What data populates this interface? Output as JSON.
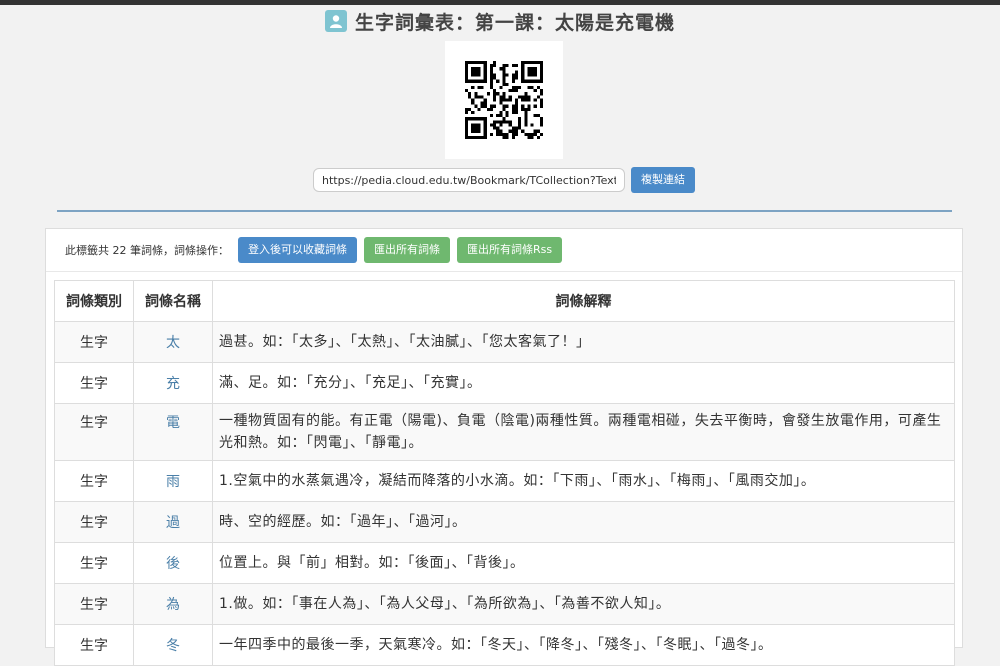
{
  "page": {
    "title": "生字詞彙表：第一課：太陽是充電機",
    "url": "https://pedia.cloud.edu.tw/Bookmark/TCollection?TextName",
    "copy_link_label": "複製連結"
  },
  "toolbar": {
    "count_text": "此標籤共 22 筆詞條，詞條操作：",
    "login_label": "登入後可以收藏詞條",
    "export_label": "匯出所有詞條",
    "export_rss_label": "匯出所有詞條Rss"
  },
  "table": {
    "headers": [
      "詞條類別",
      "詞條名稱",
      "詞條解釋"
    ],
    "rows": [
      {
        "category": "生字",
        "name": "太",
        "definition": "過甚。如：「太多」、「太熱」、「太油膩」、「您太客氣了！」"
      },
      {
        "category": "生字",
        "name": "充",
        "definition": "滿、足。如：「充分」、「充足」、「充實」。"
      },
      {
        "category": "生字",
        "name": "電",
        "definition": "一種物質固有的能。有正電（陽電)、負電（陰電)兩種性質。兩種電相碰，失去平衡時，會發生放電作用，可產生光和熱。如：「閃電」、「靜電」。"
      },
      {
        "category": "生字",
        "name": "雨",
        "definition": "1.空氣中的水蒸氣遇冷，凝結而降落的小水滴。如：「下雨」、「雨水」、「梅雨」、「風雨交加」。"
      },
      {
        "category": "生字",
        "name": "過",
        "definition": "時、空的經歷。如：「過年」、「過河」。"
      },
      {
        "category": "生字",
        "name": "後",
        "definition": "位置上。與「前」相對。如：「後面」、「背後」。"
      },
      {
        "category": "生字",
        "name": "為",
        "definition": "1.做。如：「事在人為」、「為人父母」、「為所欲為」、「為善不欲人知」。"
      },
      {
        "category": "生字",
        "name": "冬",
        "definition": "一年四季中的最後一季，天氣寒冷。如：「冬天」、「降冬」、「殘冬」、「冬眠」、「過冬」。"
      }
    ]
  }
}
